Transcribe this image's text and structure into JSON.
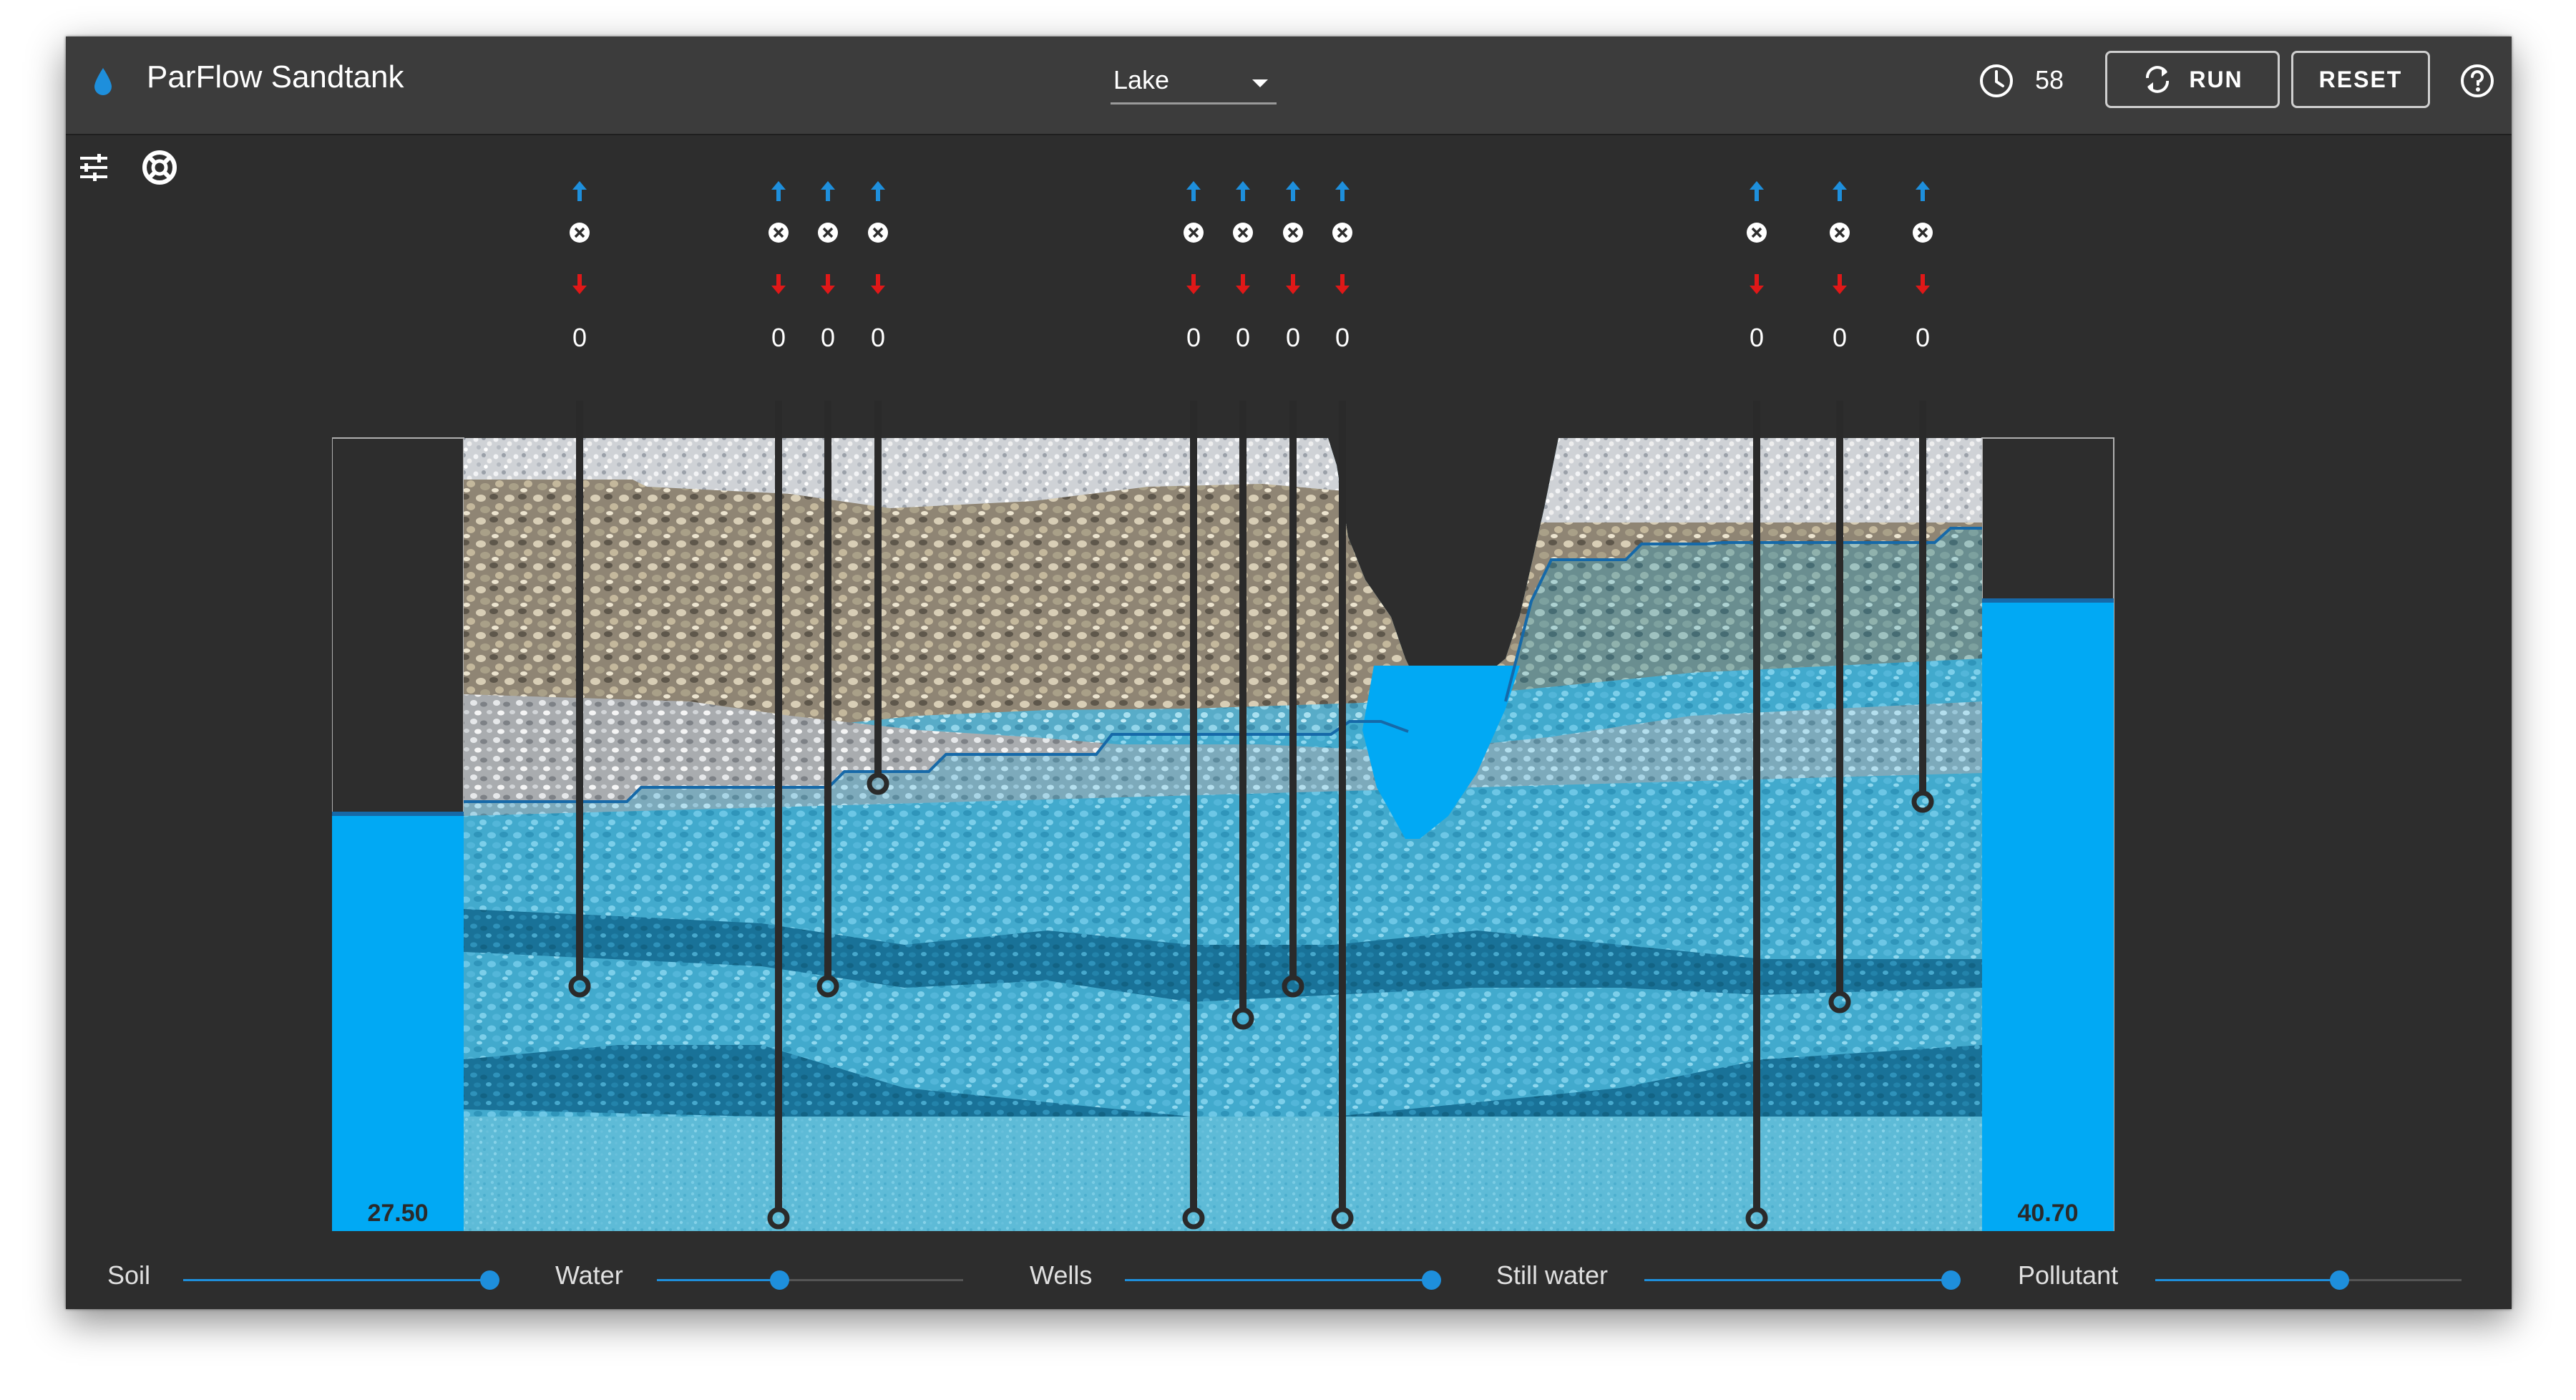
{
  "app": {
    "title": "ParFlow Sandtank"
  },
  "scenario": {
    "selected": "Lake"
  },
  "timer": {
    "value": "58"
  },
  "buttons": {
    "run_label": "RUN",
    "reset_label": "RESET"
  },
  "tank": {
    "left_level_label": "27.50",
    "right_level_label": "40.70",
    "colors": {
      "water": "#01a9f4",
      "saturated_tint": "#3aa0c8",
      "water_table_line": "#1669a8",
      "well_pipe": "#2a2a2a"
    }
  },
  "wells": [
    {
      "id": "well-1",
      "count": "0"
    },
    {
      "id": "well-2",
      "count": "0"
    },
    {
      "id": "well-3",
      "count": "0"
    },
    {
      "id": "well-4",
      "count": "0"
    },
    {
      "id": "well-5",
      "count": "0"
    },
    {
      "id": "well-6",
      "count": "0"
    },
    {
      "id": "well-7",
      "count": "0"
    },
    {
      "id": "well-8",
      "count": "0"
    },
    {
      "id": "well-9",
      "count": "0"
    },
    {
      "id": "well-10",
      "count": "0"
    },
    {
      "id": "well-11",
      "count": "0"
    }
  ],
  "sliders": [
    {
      "label": "Soil",
      "value": 1.0
    },
    {
      "label": "Water",
      "value": 0.4
    },
    {
      "label": "Wells",
      "value": 1.0
    },
    {
      "label": "Still water",
      "value": 1.0
    },
    {
      "label": "Pollutant",
      "value": 0.6
    }
  ],
  "accent_color": "#1e8fdc"
}
